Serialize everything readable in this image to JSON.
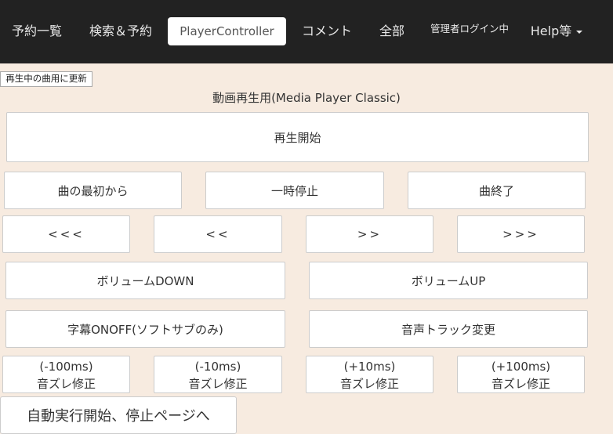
{
  "nav": {
    "items": [
      {
        "label": "予約一覧",
        "active": false
      },
      {
        "label": "検索＆予約",
        "active": false
      },
      {
        "label": "PlayerController",
        "active": true
      },
      {
        "label": "コメント",
        "active": false
      },
      {
        "label": "全部",
        "active": false
      },
      {
        "label": "管理者ログイン中",
        "active": false
      },
      {
        "label": "Help等",
        "active": false,
        "dropdown": true
      }
    ]
  },
  "refresh_button": "再生中の曲用に更新",
  "player_title": "動画再生用(Media Player Classic)",
  "buttons": {
    "play_start": "再生開始",
    "from_start": "曲の最初から",
    "pause": "一時停止",
    "song_end": "曲終了",
    "seek_back_large": "<<<",
    "seek_back": "<<",
    "seek_forward": ">>",
    "seek_forward_large": ">>>",
    "volume_down": "ボリュームDOWN",
    "volume_up": "ボリュームUP",
    "subtitle_toggle": "字幕ONOFF(ソフトサブのみ)",
    "audio_track": "音声トラック変更",
    "offset_minus_100": {
      "line1": "(-100ms)",
      "line2": "音ズレ修正"
    },
    "offset_minus_10": {
      "line1": "(-10ms)",
      "line2": "音ズレ修正"
    },
    "offset_plus_10": {
      "line1": "(+10ms)",
      "line2": "音ズレ修正"
    },
    "offset_plus_100": {
      "line1": "(+100ms)",
      "line2": "音ズレ修正"
    },
    "auto_page": "自動実行開始、停止ページへ"
  }
}
